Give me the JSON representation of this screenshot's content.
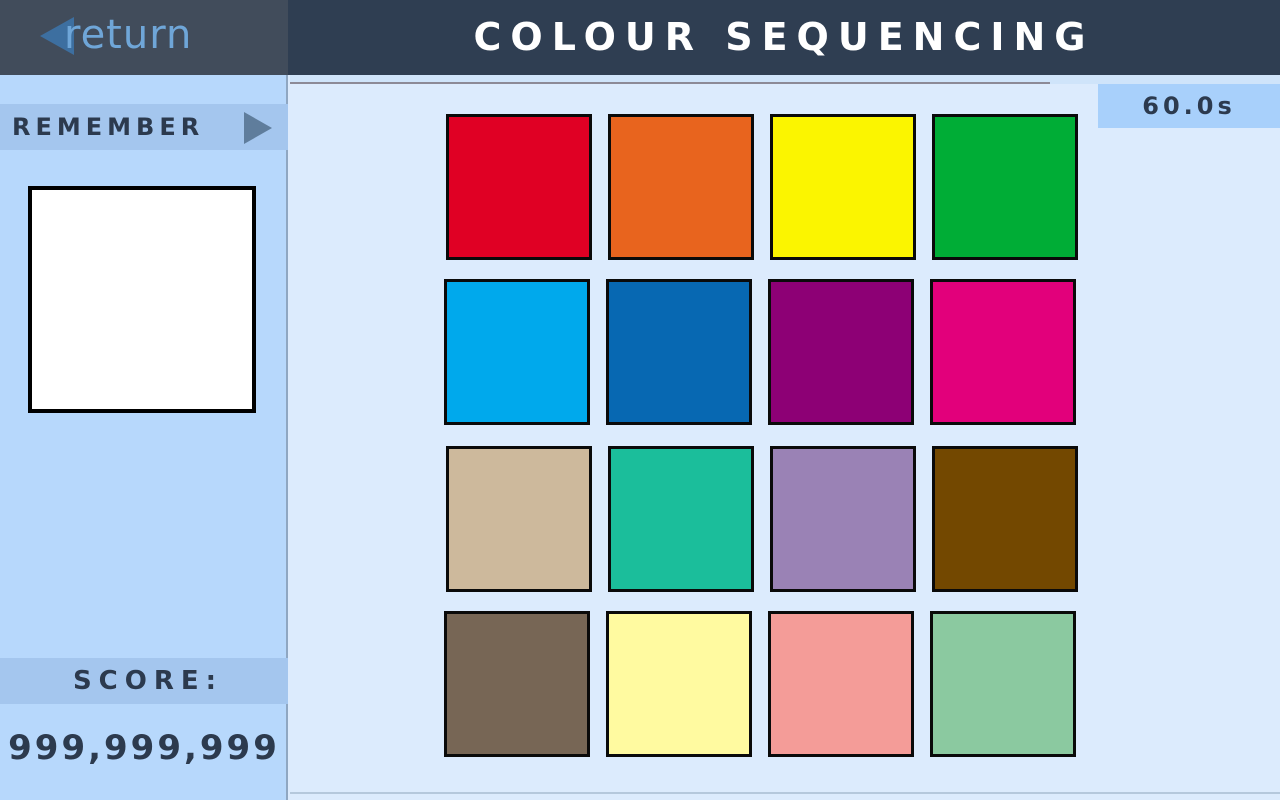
{
  "nav": {
    "return_label": "return"
  },
  "header": {
    "title": "COLOUR SEQUENCING"
  },
  "timer": {
    "text": "60.0s"
  },
  "progress": {
    "fraction": 0.0
  },
  "sidebar": {
    "remember_label": "REMEMBER",
    "preview_color": "#ffffff",
    "score_label": "SCORE:",
    "score_value": "999,999,999"
  },
  "palette": {
    "accent": "#6fa6d8",
    "header_bg": "#2f3e52",
    "sidebar_bg": "#b7d8fc",
    "main_bg": "#dcebfd"
  },
  "tiles": [
    [
      "#e00024",
      "#e8641e",
      "#fbf500",
      "#00ad36"
    ],
    [
      "#00a9ec",
      "#0768b2",
      "#8d0075",
      "#e2007b"
    ],
    [
      "#cdb99c",
      "#1bbe9b",
      "#9a82b5",
      "#734800"
    ],
    [
      "#776655",
      "#fffaa0",
      "#f49c98",
      "#8bc9a0"
    ]
  ]
}
